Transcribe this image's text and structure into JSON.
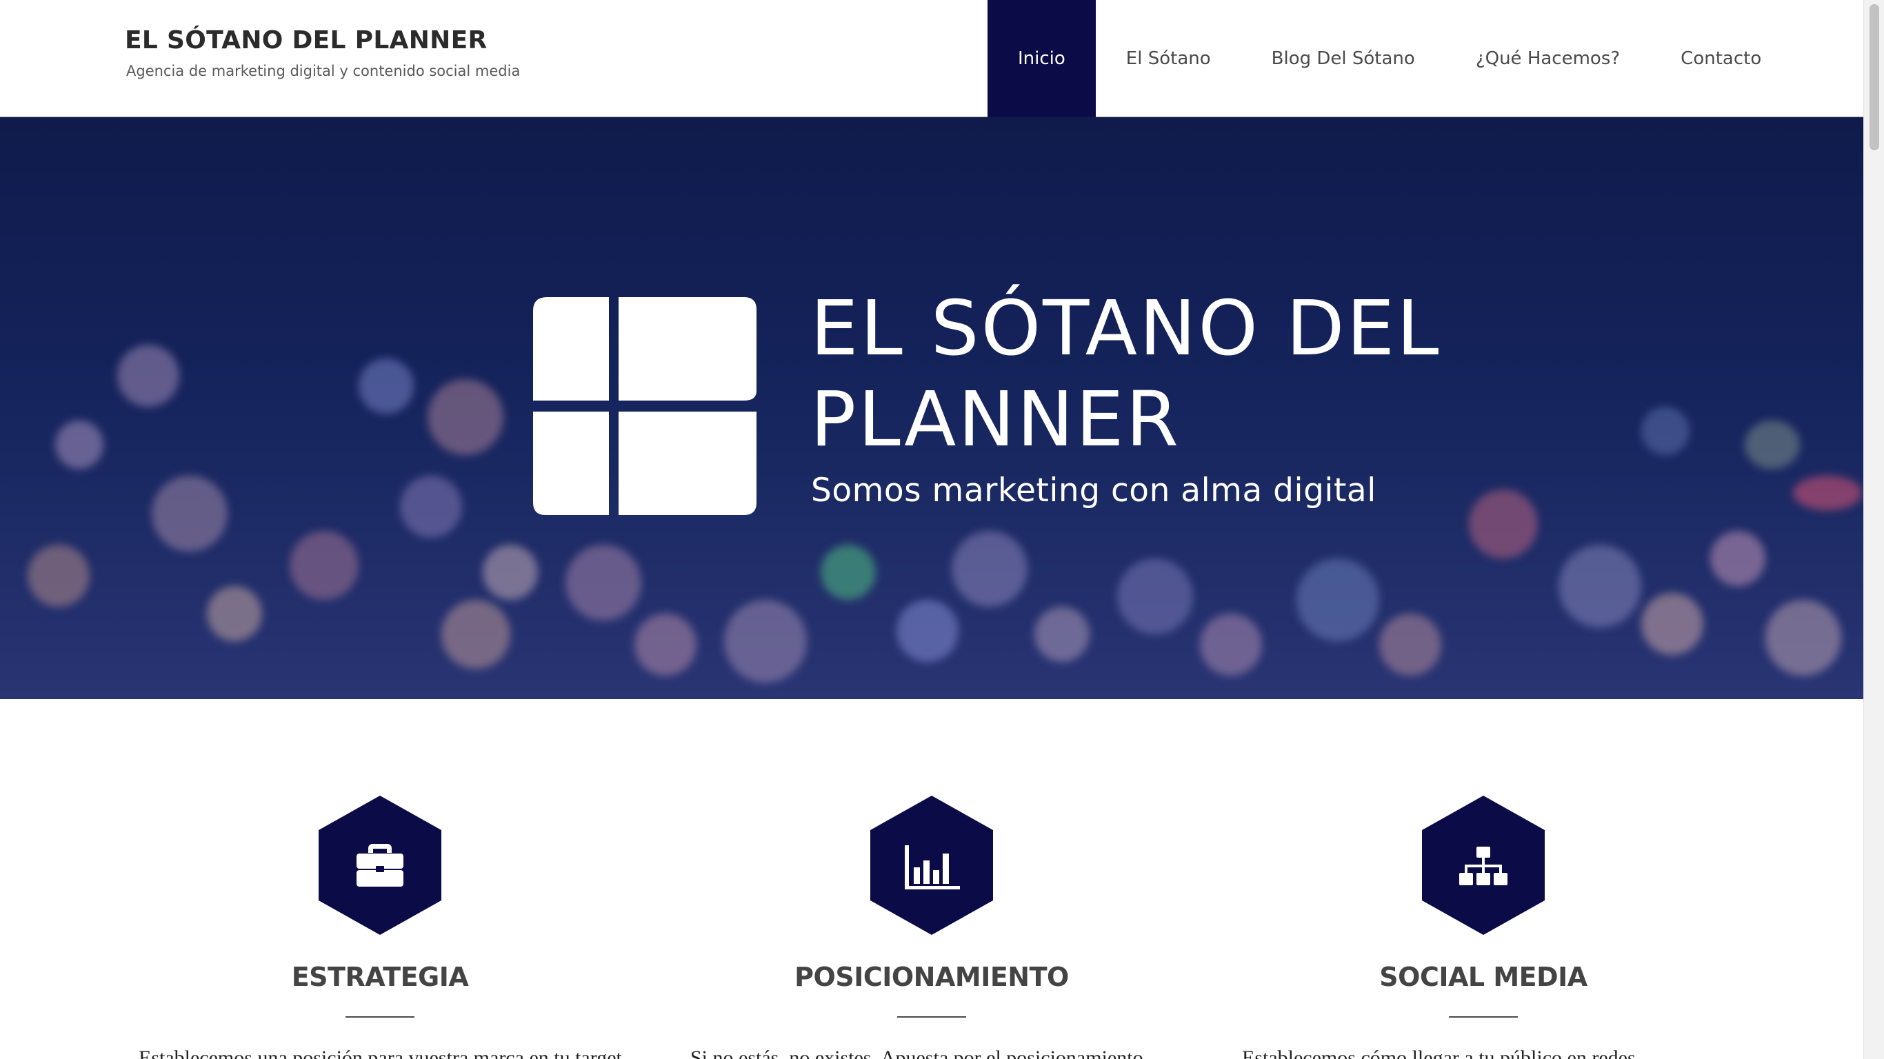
{
  "site": {
    "title": "EL SÓTANO DEL PLANNER",
    "tagline": "Agencia de marketing digital y contenido social media"
  },
  "nav": {
    "items": [
      {
        "label": "Inicio",
        "active": true
      },
      {
        "label": "El Sótano",
        "active": false
      },
      {
        "label": "Blog Del Sótano",
        "active": false
      },
      {
        "label": "¿Qué Hacemos?",
        "active": false
      },
      {
        "label": "Contacto",
        "active": false
      }
    ]
  },
  "hero": {
    "title": "EL SÓTANO DEL\nPLANNER",
    "subtitle": "Somos marketing con alma digital",
    "logo_icon": "four-rounded-squares-logo"
  },
  "services": [
    {
      "title": "ESTRATEGIA",
      "icon": "briefcase-icon",
      "text": "Establecemos una posición para vuestra marca en tu target"
    },
    {
      "title": "POSICIONAMIENTO",
      "icon": "bar-chart-icon",
      "text": "Si no estás, no existes. Apuesta por el posicionamiento"
    },
    {
      "title": "SOCIAL MEDIA",
      "icon": "org-chart-icon",
      "text": "Establecemos cómo llegar a tu público en redes"
    }
  ],
  "colors": {
    "accent": "#0b0b47",
    "hero_bg": "#14225a",
    "text_dark": "#2b2b2b"
  }
}
